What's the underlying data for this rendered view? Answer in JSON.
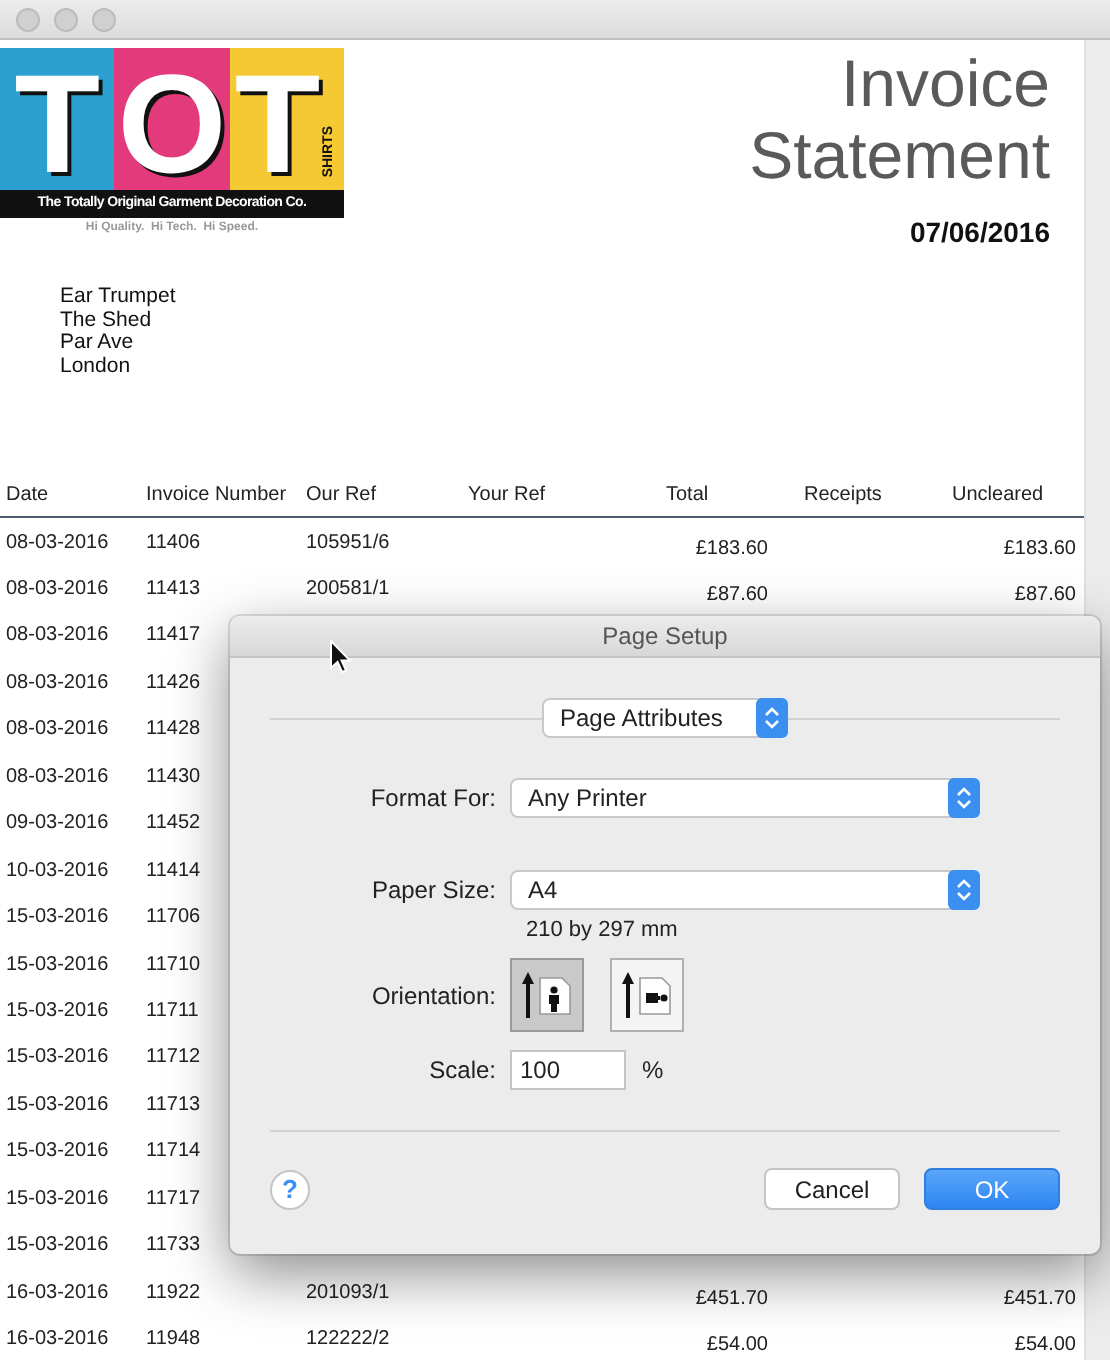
{
  "logo": {
    "letters": [
      "T",
      "O",
      "T"
    ],
    "side_text": "SHIRTS",
    "bar_text": "The Totally Original Garment Decoration Co.",
    "tagline": "Hi Quality.  Hi Tech.  Hi Speed."
  },
  "heading": {
    "title_lines": [
      "Invoice",
      "Statement"
    ],
    "date": "07/06/2016"
  },
  "address": [
    "Ear Trumpet",
    "The Shed",
    "Par Ave",
    "London"
  ],
  "table": {
    "columns": [
      "Date",
      "Invoice Number",
      "Our Ref",
      "Your Ref",
      "Total",
      "Receipts",
      "Uncleared"
    ],
    "rows": [
      {
        "date": "08-03-2016",
        "invoice_number": "11406",
        "our_ref": "105951/6",
        "total": "£183.60",
        "uncleared": "£183.60"
      },
      {
        "date": "08-03-2016",
        "invoice_number": "11413",
        "our_ref": "200581/1",
        "total": "£87.60",
        "uncleared": "£87.60"
      },
      {
        "date": "08-03-2016",
        "invoice_number": "11417"
      },
      {
        "date": "08-03-2016",
        "invoice_number": "11426"
      },
      {
        "date": "08-03-2016",
        "invoice_number": "11428"
      },
      {
        "date": "08-03-2016",
        "invoice_number": "11430"
      },
      {
        "date": "09-03-2016",
        "invoice_number": "11452"
      },
      {
        "date": "10-03-2016",
        "invoice_number": "11414"
      },
      {
        "date": "15-03-2016",
        "invoice_number": "11706"
      },
      {
        "date": "15-03-2016",
        "invoice_number": "11710"
      },
      {
        "date": "15-03-2016",
        "invoice_number": "11711"
      },
      {
        "date": "15-03-2016",
        "invoice_number": "11712"
      },
      {
        "date": "15-03-2016",
        "invoice_number": "11713"
      },
      {
        "date": "15-03-2016",
        "invoice_number": "11714"
      },
      {
        "date": "15-03-2016",
        "invoice_number": "11717"
      },
      {
        "date": "15-03-2016",
        "invoice_number": "11733"
      },
      {
        "date": "16-03-2016",
        "invoice_number": "11922",
        "our_ref": "201093/1",
        "total": "£451.70",
        "uncleared": "£451.70"
      },
      {
        "date": "16-03-2016",
        "invoice_number": "11948",
        "our_ref": "122222/2",
        "total": "£54.00",
        "uncleared": "£54.00"
      }
    ]
  },
  "dialog": {
    "title": "Page Setup",
    "section_popup": "Page Attributes",
    "format_for": {
      "label": "Format For:",
      "value": "Any Printer"
    },
    "paper_size": {
      "label": "Paper Size:",
      "value": "A4",
      "dimensions": "210 by 297 mm"
    },
    "orientation": {
      "label": "Orientation:",
      "options": [
        {
          "kind": "portrait",
          "selected": true
        },
        {
          "kind": "landscape",
          "selected": false
        }
      ]
    },
    "scale": {
      "label": "Scale:",
      "value": "100",
      "unit": "%"
    },
    "help": "?",
    "buttons": [
      {
        "label": "Cancel",
        "default": false
      },
      {
        "label": "OK",
        "default": true
      }
    ]
  }
}
